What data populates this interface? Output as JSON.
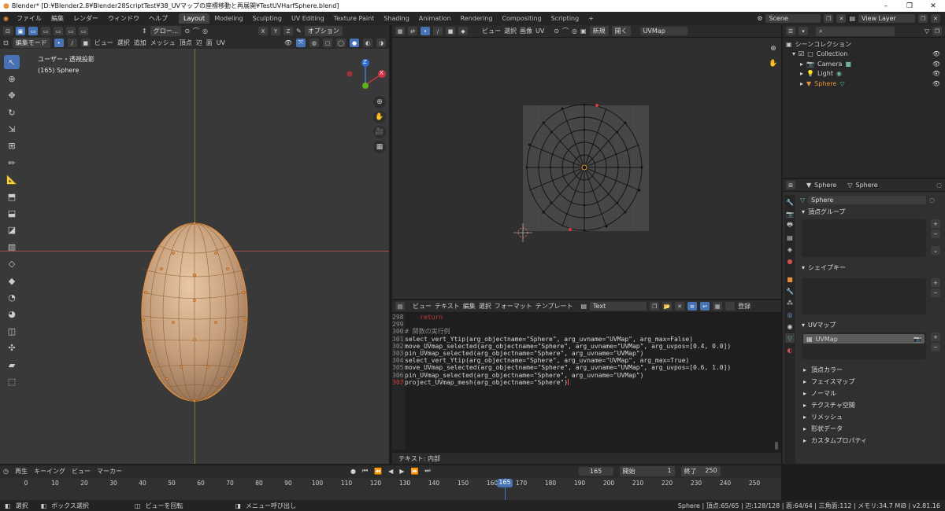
{
  "title": "Blender* [D:¥Blender2.8¥Blender28ScriptTest¥38_UVマップの座標移動と再展開¥TestUVHarfSphere.blend]",
  "window_controls": [
    "–",
    "❐",
    "✕"
  ],
  "menu": [
    "ファイル",
    "編集",
    "レンダー",
    "ウィンドウ",
    "ヘルプ"
  ],
  "workspaces": [
    {
      "label": "Layout",
      "active": true
    },
    {
      "label": "Modeling"
    },
    {
      "label": "Sculpting"
    },
    {
      "label": "UV Editing"
    },
    {
      "label": "Texture Paint"
    },
    {
      "label": "Shading"
    },
    {
      "label": "Animation"
    },
    {
      "label": "Rendering"
    },
    {
      "label": "Compositing"
    },
    {
      "label": "Scripting"
    },
    {
      "label": "+"
    }
  ],
  "scene": "Scene",
  "view_layer": "View Layer",
  "viewport": {
    "mode": "編集モード",
    "menus": [
      "ビュー",
      "選択",
      "追加",
      "メッシュ",
      "頂点",
      "辺",
      "面",
      "UV"
    ],
    "transform": "グロー...",
    "axes": [
      "X",
      "Y",
      "Z"
    ],
    "options": "オプション",
    "info1": "ユーザー・透視投影",
    "info2": "(165) Sphere",
    "gizmo_z": "Z",
    "gizmo_x": "X",
    "accent_orange": "#e8913a"
  },
  "uv_editor": {
    "menus": [
      "ビュー",
      "選択",
      "画像",
      "UV"
    ],
    "new": "新規",
    "open": "開く",
    "uvmap": "UVMap",
    "grid_color": "#3d3d3d"
  },
  "text_editor": {
    "menus": [
      "ビュー",
      "テキスト",
      "編集",
      "選択",
      "フォーマット",
      "テンプレート"
    ],
    "name": "Text",
    "register": "登録",
    "footer": "テキスト: 内部",
    "lines": [
      {
        "n": "298",
        "t": "    return",
        "c": "#cc3a3a"
      },
      {
        "n": "299",
        "t": ""
      },
      {
        "n": "300",
        "t": "# 関数の実行例",
        "c": "#8c8c8c"
      },
      {
        "n": "301",
        "t": "select_vert_Ytip(arg_objectname=\"Sphere\", arg_uvname=\"UVMap\", arg_max=False)"
      },
      {
        "n": "302",
        "t": "move_UVmap_selected(arg_objectname=\"Sphere\", arg_uvname=\"UVMap\", arg_uvpos=[0.4, 0.0])"
      },
      {
        "n": "303",
        "t": "pin_UVmap_selected(arg_objectname=\"Sphere\", arg_uvname=\"UVMap\")"
      },
      {
        "n": "304",
        "t": "select_vert_Ytip(arg_objectname=\"Sphere\", arg_uvname=\"UVMap\", arg_max=True)"
      },
      {
        "n": "305",
        "t": "move_UVmap_selected(arg_objectname=\"Sphere\", arg_uvname=\"UVMap\", arg_uvpos=[0.6, 1.0])"
      },
      {
        "n": "306",
        "t": "pin_UVmap_selected(arg_objectname=\"Sphere\", arg_uvname=\"UVMap\")"
      },
      {
        "n": "307",
        "t": "project_UVmap_mesh(arg_objectname=\"Sphere\")",
        "ln": "#d23c3c"
      }
    ]
  },
  "outliner": {
    "scene_collection": "シーンコレクション",
    "collection": "Collection",
    "items": [
      {
        "label": "Camera",
        "icon": "camera-icon",
        "color": "#e8913a"
      },
      {
        "label": "Light",
        "icon": "light-icon",
        "color": "#e8913a"
      },
      {
        "label": "Sphere",
        "icon": "mesh-icon",
        "color": "#e8913a",
        "active": true
      }
    ]
  },
  "properties": {
    "obj": "Sphere",
    "mesh": "Sphere",
    "data_name": "Sphere",
    "sections": {
      "vgroups": "頂点グループ",
      "shapekeys": "シェイプキー",
      "uvmaps": "UVマップ"
    },
    "uvmap_item": "UVMap",
    "sub": [
      "頂点カラー",
      "フェイスマップ",
      "ノーマル",
      "テクスチャ空間",
      "リメッシュ",
      "形状データ",
      "カスタムプロパティ"
    ]
  },
  "timeline": {
    "menus": [
      "再生",
      "キーイング",
      "ビュー",
      "マーカー"
    ],
    "current": "165",
    "start_label": "開始",
    "start": "1",
    "end_label": "終了",
    "end": "250",
    "ticks": [
      "0",
      "10",
      "20",
      "30",
      "40",
      "50",
      "60",
      "70",
      "80",
      "90",
      "100",
      "110",
      "120",
      "130",
      "140",
      "150",
      "160",
      "165",
      "170",
      "180",
      "190",
      "200",
      "210",
      "220",
      "230",
      "240",
      "250"
    ]
  },
  "status": {
    "select": "選択",
    "box": "ボックス選択",
    "rotate": "ビューを回転",
    "menu": "メニュー呼び出し",
    "stats": "Sphere | 頂点:65/65 | 辺:128/128 | 面:64/64 | 三角面:112 | メモリ:34.7 MiB | v2.81.16"
  }
}
